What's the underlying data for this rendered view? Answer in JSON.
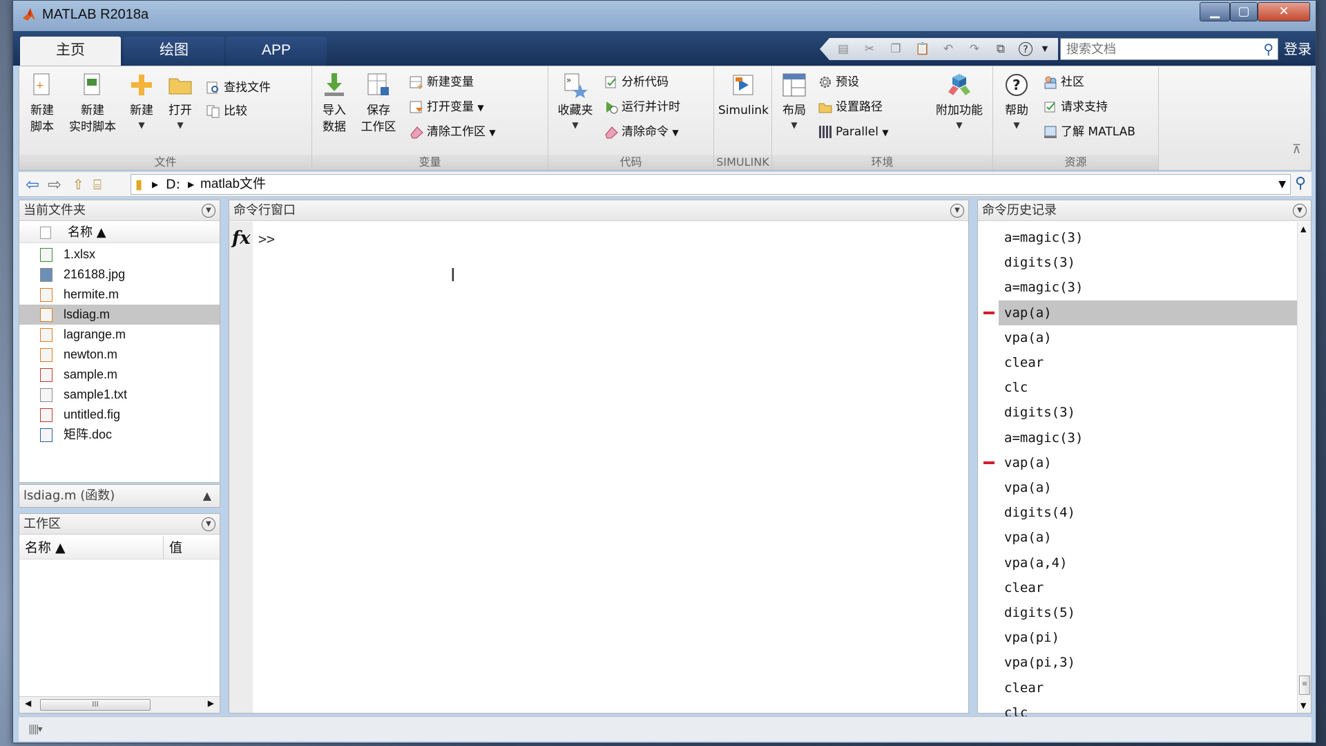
{
  "window": {
    "title": "MATLAB R2018a"
  },
  "tabs": [
    {
      "label": "主页",
      "active": true
    },
    {
      "label": "绘图",
      "active": false
    },
    {
      "label": "APP",
      "active": false
    }
  ],
  "search": {
    "placeholder": "搜索文档"
  },
  "login_label": "登录",
  "ribbon": {
    "file": {
      "label": "文件",
      "new_script": [
        "新建",
        "脚本"
      ],
      "new_live_script": [
        "新建",
        "实时脚本"
      ],
      "new": "新建",
      "open": "打开",
      "find_files": "查找文件",
      "compare": "比较"
    },
    "variable": {
      "label": "变量",
      "import_data": [
        "导入",
        "数据"
      ],
      "save_workspace": [
        "保存",
        "工作区"
      ],
      "new_variable": "新建变量",
      "open_variable": "打开变量",
      "clear_workspace": "清除工作区"
    },
    "code": {
      "label": "代码",
      "favorites": "收藏夹",
      "analyze_code": "分析代码",
      "run_and_time": "运行并计时",
      "clear_commands": "清除命令"
    },
    "simulink": {
      "label": "SIMULINK",
      "simulink": "Simulink"
    },
    "environment": {
      "label": "环境",
      "layout": "布局",
      "preferences": "预设",
      "set_path": "设置路径",
      "parallel": "Parallel",
      "add_ons": "附加功能"
    },
    "resources": {
      "label": "资源",
      "help": "帮助",
      "community": "社区",
      "request_support": "请求支持",
      "learn_matlab": "了解 MATLAB"
    }
  },
  "address": {
    "drive": "D:",
    "folder": "matlab文件"
  },
  "current_folder": {
    "title": "当前文件夹",
    "name_column": "名称 ▲",
    "files": [
      "1.xlsx",
      "216188.jpg",
      "hermite.m",
      "lsdiag.m",
      "lagrange.m",
      "newton.m",
      "sample.m",
      "sample1.txt",
      "untitled.fig",
      "矩阵.doc"
    ],
    "selected_index": 3,
    "detail": "lsdiag.m  (函数)"
  },
  "workspace": {
    "title": "工作区",
    "name_column": "名称 ▲",
    "value_column": "值"
  },
  "command_window": {
    "title": "命令行窗口",
    "fx": "fx",
    "prompt": ">>"
  },
  "history": {
    "title": "命令历史记录",
    "items": [
      "a=magic(3)",
      "digits(3)",
      "a=magic(3)",
      "vap(a)",
      "vpa(a)",
      "clear",
      "clc",
      "digits(3)",
      "a=magic(3)",
      "vap(a)",
      "vpa(a)",
      "digits(4)",
      "vpa(a)",
      "vpa(a,4)",
      "clear",
      "digits(5)",
      "vpa(pi)",
      "vpa(pi,3)",
      "clear",
      "clc"
    ],
    "selected_index": 3,
    "error_indices": [
      3,
      9
    ]
  },
  "colors": {
    "accent": "#17325a",
    "error_mark": "#d21f2b",
    "selected_row": "#c4c4c4"
  }
}
